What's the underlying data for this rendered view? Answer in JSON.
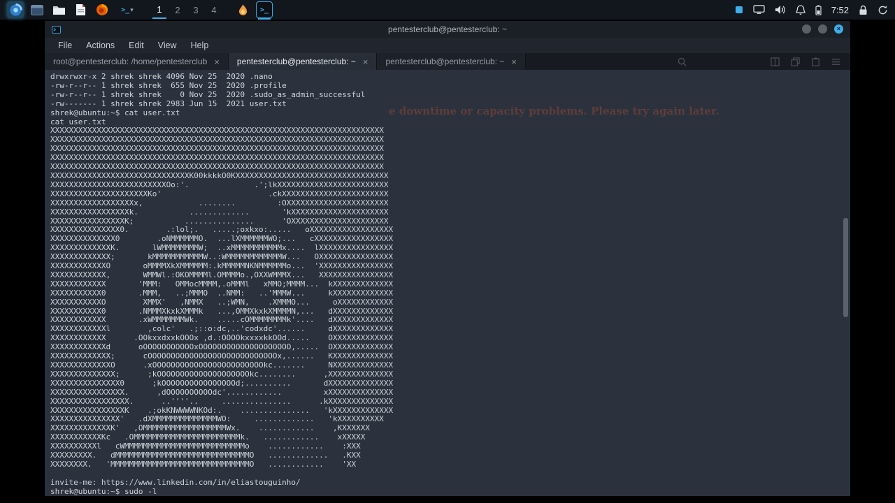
{
  "panel": {
    "desktops": [
      "1",
      "2",
      "3",
      "4"
    ],
    "active_desktop": "1",
    "clock": "7:52"
  },
  "window": {
    "title": "pentesterclub@pentesterclub: ~",
    "menu": [
      "File",
      "Actions",
      "Edit",
      "View",
      "Help"
    ],
    "tabs": [
      {
        "label": "root@pentesterclub: /home/pentesterclub",
        "close_glyph": "×",
        "active": false
      },
      {
        "label": "pentesterclub@pentesterclub: ~",
        "close_glyph": "×",
        "active": true
      },
      {
        "label": "pentesterclub@pentesterclub: ~",
        "close_glyph": "×",
        "active": false
      }
    ],
    "controls": {
      "close_glyph": "×"
    }
  },
  "terminal": {
    "lines_before_art": [
      "drwxrwxr-x 2 shrek shrek 4096 Nov 25  2020 .nano",
      "-rw-r--r-- 1 shrek shrek  655 Nov 25  2020 .profile",
      "-rw-r--r-- 1 shrek shrek    0 Nov 25  2020 .sudo_as_admin_successful",
      "-rw------- 1 shrek shrek 2983 Jun 15  2021 user.txt",
      "shrek@ubuntu:~$ cat user.txt",
      "cat user.txt"
    ],
    "ascii_art": [
      "XXXXXXXXXXXXXXXXXXXXXXXXXXXXXXXXXXXXXXXXXXXXXXXXXXXXXXXXXXXXXXXXXXXXXXXX",
      "XXXXXXXXXXXXXXXXXXXXXXXXXXXXXXXXXXXXXXXXXXXXXXXXXXXXXXXXXXXXXXXXXXXXXXXX",
      "XXXXXXXXXXXXXXXXXXXXXXXXXXXXXXXXXXXXXXXXXXXXXXXXXXXXXXXXXXXXXXXXXXXXXXXX",
      "XXXXXXXXXXXXXXXXXXXXXXXXXXXXXXXXXXXXXXXXXXXXXXXXXXXXXXXXXXXXXXXXXXXXXXXX",
      "XXXXXXXXXXXXXXXXXXXXXXXXXXXXXXXXXXXXXXXXXXXXXXXXXXXXXXXXXXXXXXXXXXXXXXXX",
      "XXXXXXXXXXXXXXXXXXXXXXXXXXXXXXK00kkkkO0KXXXXXXXXXXXXXXXXXXXXXXXXXXXXXXXXX",
      "XXXXXXXXXXXXXXXXXXXXXXXXXOo:'.              .';lkXXXXXXXXXXXXXXXXXXXXXXXX",
      "XXXXXXXXXXXXXXXXXXXXXKo'                       .ckXXXXXXXXXXXXXXXXXXXXXXX",
      "XXXXXXXXXXXXXXXXXXx,            ........         :OXXXXXXXXXXXXXXXXXXXXXX",
      "XXXXXXXXXXXXXXXXXk.           .............       'kXXXXXXXXXXXXXXXXXXXXX",
      "XXXXXXXXXXXXXXXXK;           ...............      'OXXXXXXXXXXXXXXXXXXXXX",
      "XXXXXXXXXXXXXXX0.        .:lol;.   .....;oxkxo:.....   oXXXXXXXXXXXXXXXXXX",
      "XXXXXXXXXXXXXX0        .oNMMMMMMO.  ...lXMMMMMMWO;...   cXXXXXXXXXXXXXXXXX",
      "XXXXXXXXXXXXXK.       lWMMMMMMMMW;  ..xMMMMMMMMMMMx....  lXXXXXXXXXXXXXXXX",
      "XXXXXXXXXXXXX;       kMMMMMMMMMMMW..:WMMMMMMMMMMMMW...   OXXXXXXXXXXXXXXXX",
      "XXXXXXXXXXXXO       oMMMMXkXMMMMMM:.kMMMMMNKNMMMMMMo...  'XXXXXXXXXXXXXXXX",
      "XXXXXXXXXXXX,       WMMWl.:OKOMMMMl.OMMMMo.,OXXWMMMX...   XXXXXXXXXXXXXXXX",
      "XXXXXXXXXXXX       'MMM:   OMMocMMMM,.oMMMl   xMMO;MMMM...  kXXXXXXXXXXXXX",
      "XXXXXXXXXXX0       .MMM,   ..;MMMO  ..NMM:   ..'MMMW...     kXXXXXXXXXXXXX",
      "XXXXXXXXXXXO        XMMX'   ,NMMX   ..;WMN,    .XMMMO...     oXXXXXXXXXXXX",
      "XXXXXXXXXXX0       .NMMMXkxkXMMMk   ...,OMMXkxkXMMMMN,...   dXXXXXXXXXXXXX",
      "XXXXXXXXXXXX       .xWMMMMMMMWk.    .....cOMMMMMMMMk'....   dXXXXXXXXXXXXX",
      "XXXXXXXXXXXXl        ,colc'   .;::o:dc,..'codxdc'......     dXXXXXXXXXXXXX",
      "XXXXXXXXXXXX      .OOkxxdxxkOOOx ,d.:OOOOkxxxxkkOOd.....    OXXXXXXXXXXXXX",
      "XXXXXXXXXXXXd      oOOOOOOOOOOOxOOOOOOOOOOOOOOOOOOOO,.....  OXXXXXXXXXXXXX",
      "XXXXXXXXXXXXX;      cOOOOOOOOOOOOOOOOOOOOOOOOOOOOx,......   KXXXXXXXXXXXXX",
      "XXXXXXXXXXXXXO      .xOOOOOOOOOOOOOOOOOOOOOOOOkc.......     NXXXXXXXXXXXXX",
      "XXXXXXXXXXXXXX;      ;kOOOOOOOOOOOOOOOOOOOOkc........      ,XXXXXXXXXXXXXX",
      "XXXXXXXXXXXXXXX0      ;kOOOOOOOOOOOOOOOOd;..........       dXXXXXXXXXXXXXX",
      "XXXXXXXXXXXXXXXX.      ,dOOOOOOOOOOdc'............         xXXXXXXXXXXXXXX",
      "XXXXXXXXXXXXXXXXX.      ..''''..     ...............      .kXXXXXXXXXXXXXX",
      "XXXXXXXXXXXXXXXXK    .;okKNWWWWNKOd:.    ...............   'kXXXXXXXXXXXXX",
      "XXXXXXXXXXXXXXX'   .dXMMMMMMMMMMMMMMWO:     .............   'kXXXXXXXXXX",
      "XXXXXXXXXXXXXK'   ,OMMMMMMMMMMMMMMMMMMWx.    ............    ,KXXXXXX",
      "XXXXXXXXXXXKc   .OMMMMMMMMMMMMMMMMMMMMMMMk.   ............    xXXXXX",
      "XXXXXXXXXXl   cWMMMMMMMMMMMMMMMMMMMMMMMMMMo    ............    :XXX",
      "XXXXXXXXX.   dMMMMMMMMMMMMMMMMMMMMMMMMMMMMMO   .............   .KXX",
      "XXXXXXXX.   'MMMMMMMMMMMMMMMMMMMMMMMMMMMMMMO   ............    'XX"
    ],
    "lines_after_art": [
      "",
      "invite-me: https://www.linkedin.com/in/eliastouguinho/",
      "shrek@ubuntu:~$ sudo -l"
    ]
  },
  "wallpaper": {
    "ghost_text": "e downtime or capacity problems. Please try again later."
  },
  "icons": {
    "terminal_glyph": ">_",
    "dropdown_glyph": "▾"
  },
  "colors": {
    "accent": "#3daee9",
    "panel_bg": "#12161d",
    "terminal_bg": "#2b323d",
    "terminal_fg": "#ccd2d9",
    "titlebar_bg": "#1b1f26",
    "close_button": "#3daee9"
  }
}
